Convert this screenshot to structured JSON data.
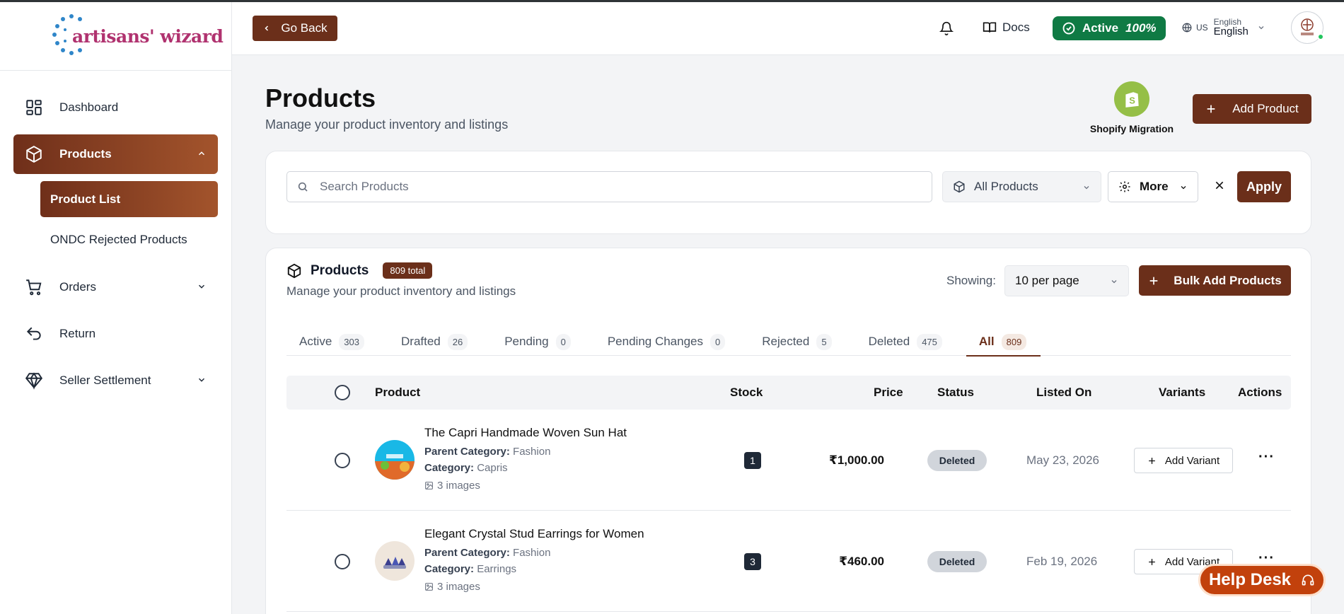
{
  "brand": {
    "logo_text": "artisans' wizard"
  },
  "sidebar": {
    "items": [
      {
        "label": "Dashboard"
      },
      {
        "label": "Products"
      },
      {
        "label": "Orders"
      },
      {
        "label": "Return"
      },
      {
        "label": "Seller Settlement"
      }
    ],
    "products_sub": [
      {
        "label": "Product List"
      },
      {
        "label": "ONDC Rejected Products"
      }
    ]
  },
  "header": {
    "go_back": "Go Back",
    "docs": "Docs",
    "status_label": "Active",
    "status_pct": "100%",
    "lang_code": "US",
    "lang_small": "English",
    "lang_big": "English"
  },
  "page": {
    "title": "Products",
    "subtitle": "Manage your product inventory and listings",
    "shopify_label": "Shopify Migration",
    "add_product": "Add Product"
  },
  "filters": {
    "search_placeholder": "Search Products",
    "category": "All Products",
    "more": "More",
    "apply": "Apply"
  },
  "products_card": {
    "title": "Products",
    "total_badge": "809 total",
    "subtitle": "Manage your product inventory and listings",
    "showing_label": "Showing:",
    "per_page": "10 per page",
    "bulk_add": "Bulk Add Products"
  },
  "tabs": [
    {
      "label": "Active",
      "count": "303"
    },
    {
      "label": "Drafted",
      "count": "26"
    },
    {
      "label": "Pending",
      "count": "0"
    },
    {
      "label": "Pending Changes",
      "count": "0"
    },
    {
      "label": "Rejected",
      "count": "5"
    },
    {
      "label": "Deleted",
      "count": "475"
    },
    {
      "label": "All",
      "count": "809"
    }
  ],
  "table": {
    "headers": {
      "product": "Product",
      "stock": "Stock",
      "price": "Price",
      "status": "Status",
      "listed_on": "Listed On",
      "variants": "Variants",
      "actions": "Actions"
    },
    "rows": [
      {
        "name": "The Capri Handmade Woven Sun Hat",
        "parent_label": "Parent Category:",
        "parent": "Fashion",
        "category_label": "Category:",
        "category": "Capris",
        "images": "3 images",
        "stock": "1",
        "price": "₹1,000.00",
        "status": "Deleted",
        "listed_on": "May 23, 2026",
        "variant_btn": "Add Variant"
      },
      {
        "name": "Elegant Crystal Stud Earrings for Women",
        "parent_label": "Parent Category:",
        "parent": "Fashion",
        "category_label": "Category:",
        "category": "Earrings",
        "images": "3 images",
        "stock": "3",
        "price": "₹460.00",
        "status": "Deleted",
        "listed_on": "Feb 19, 2026",
        "variant_btn": "Add Variant"
      }
    ]
  },
  "help_desk": "Help Desk",
  "colors": {
    "brand_brown": "#6b2f1a",
    "active_green": "#0f7a44",
    "shopify_green": "#95bf47",
    "help_orange": "#c2410c"
  }
}
